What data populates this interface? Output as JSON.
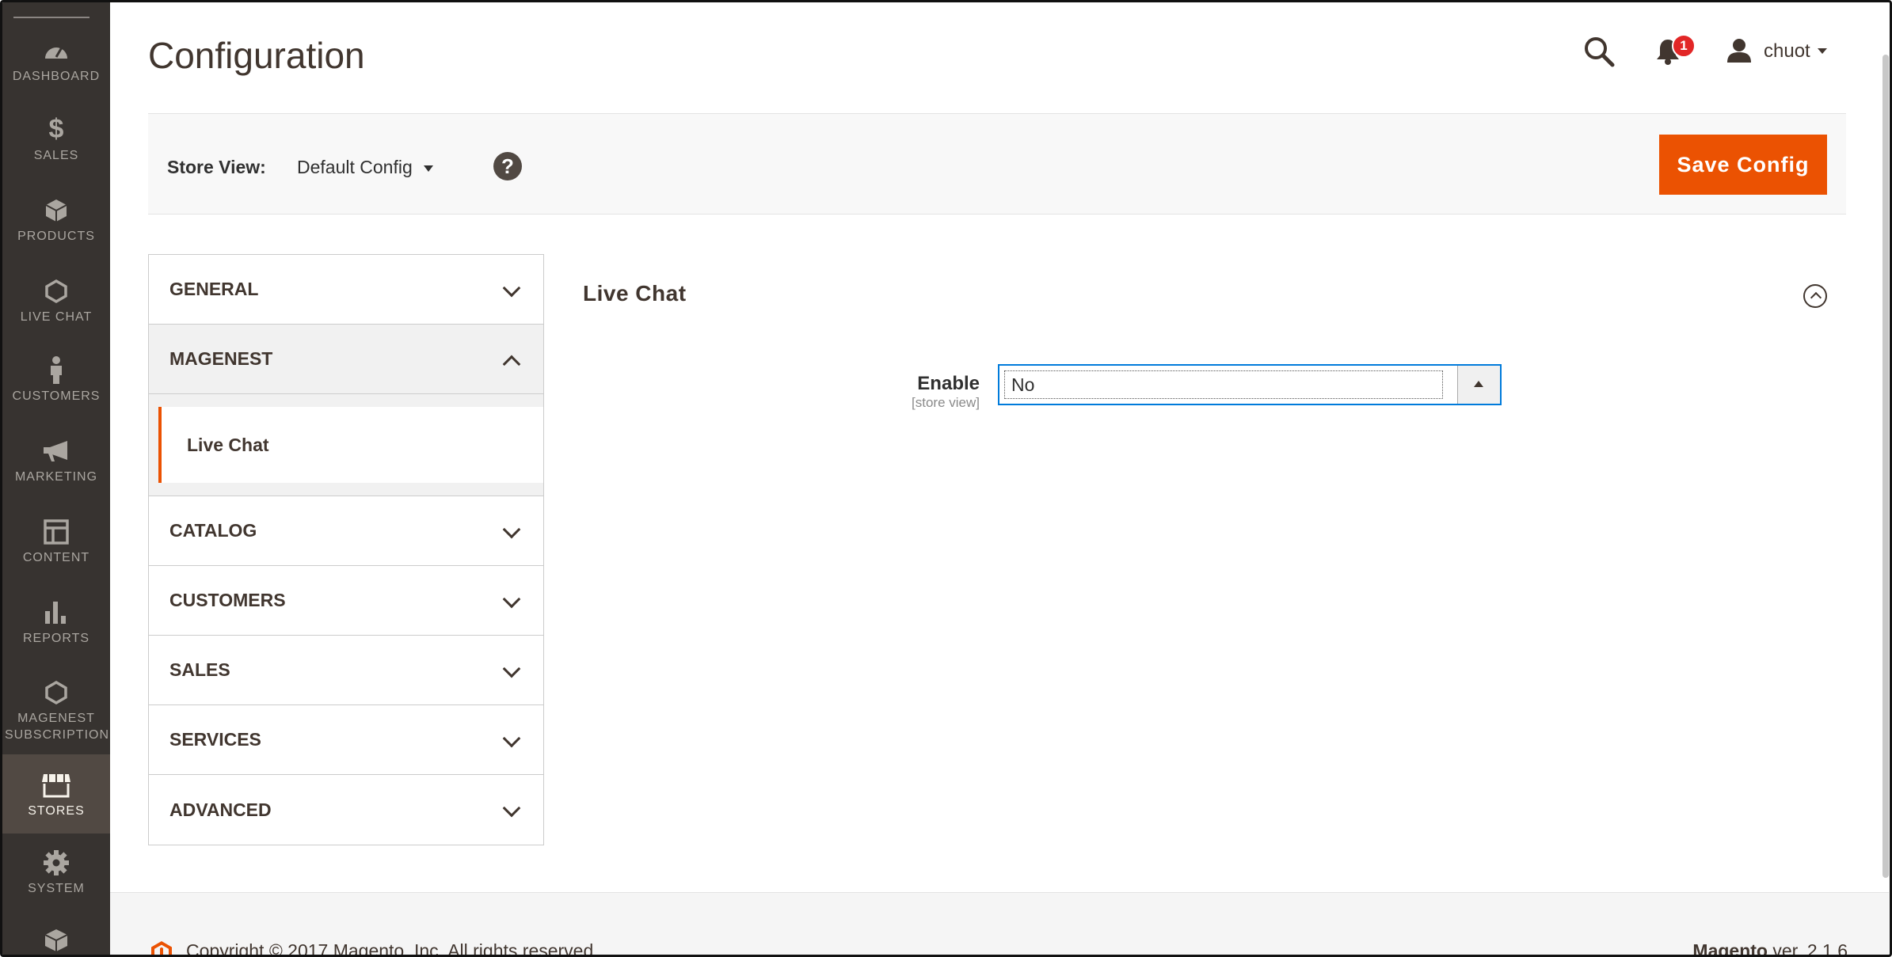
{
  "sidebar": {
    "items": [
      {
        "label": "DASHBOARD",
        "icon": "dashboard-icon"
      },
      {
        "label": "SALES",
        "icon": "dollar-icon"
      },
      {
        "label": "PRODUCTS",
        "icon": "cube-icon"
      },
      {
        "label": "LIVE CHAT",
        "icon": "hexagon-icon"
      },
      {
        "label": "CUSTOMERS",
        "icon": "person-icon"
      },
      {
        "label": "MARKETING",
        "icon": "megaphone-icon"
      },
      {
        "label": "CONTENT",
        "icon": "layout-icon"
      },
      {
        "label": "REPORTS",
        "icon": "bar-chart-icon"
      },
      {
        "label": "MAGENEST SUBSCRIPTION",
        "icon": "hexagon-icon"
      },
      {
        "label": "STORES",
        "icon": "store-icon",
        "active": true
      },
      {
        "label": "SYSTEM",
        "icon": "gear-icon"
      }
    ]
  },
  "header": {
    "title": "Configuration",
    "notification_count": "1",
    "user_name": "chuot"
  },
  "store_view": {
    "label": "Store View:",
    "value": "Default Config",
    "help": "?"
  },
  "actions": {
    "save_label": "Save Config"
  },
  "tabs": {
    "general": "GENERAL",
    "magenest": "MAGENEST",
    "magenest_sub": "Live Chat",
    "catalog": "CATALOG",
    "customers": "CUSTOMERS",
    "sales": "SALES",
    "services": "SERVICES",
    "advanced": "ADVANCED"
  },
  "section": {
    "title": "Live Chat",
    "field_label": "Enable",
    "field_scope": "[store view]",
    "field_value": "No"
  },
  "footer": {
    "copyright": "Copyright © 2017 Magento, Inc. All rights reserved.",
    "brand": "Magento",
    "version": " ver. 2.1.6"
  },
  "colors": {
    "sidebar_bg": "#373330",
    "accent": "#eb5202",
    "focus": "#007bdb"
  }
}
